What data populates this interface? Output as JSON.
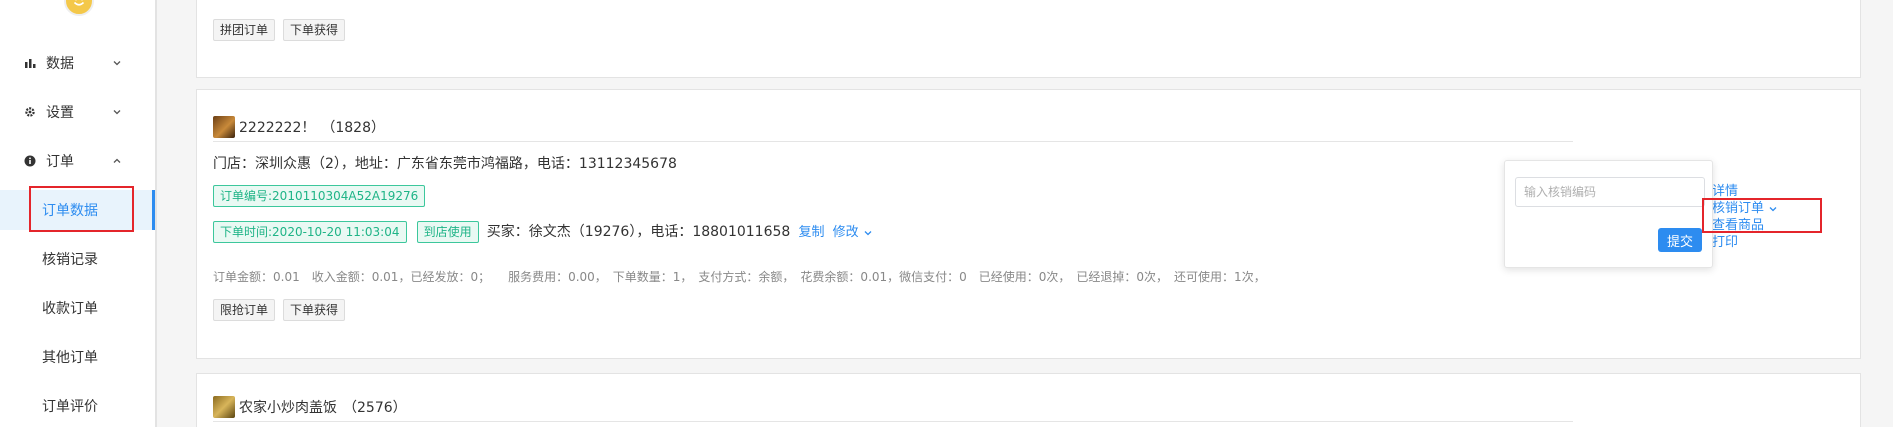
{
  "sidebar": {
    "groups": [
      {
        "label": "数据",
        "icon": "bar-chart-icon",
        "expanded": false
      },
      {
        "label": "设置",
        "icon": "gear-icon",
        "expanded": false
      },
      {
        "label": "订单",
        "icon": "info-circle-icon",
        "expanded": true
      }
    ],
    "order_items": [
      "订单数据",
      "核销记录",
      "收款订单",
      "其他订单",
      "订单评价"
    ],
    "active_item": "订单数据"
  },
  "order_prev": {
    "tags": [
      "拼团订单",
      "下单获得"
    ]
  },
  "order_main": {
    "shop_name": "2222222！",
    "shop_id": "（1828）",
    "store_line": "门店：深圳众惠（2），地址：广东省东莞市鸿福路，电话：13112345678",
    "order_no": "订单编号:2010110304A52A19276",
    "order_time": "下单时间:2020-10-20 11:03:04",
    "use_type": "到店使用",
    "buyer_line": "买家：徐文杰（19276），电话：18801011658",
    "copy_label": "复制",
    "edit_label": "修改",
    "summary": "订单金额：0.01　收入金额：0.01，已经发放：0；　　服务费用：0.00，　下单数量：1，　支付方式：余额，　花费余额：0.01，微信支付：0　已经使用：0次，　已经退掉：0次，　还可使用：1次，",
    "tags": [
      "限抢订单",
      "下单获得"
    ]
  },
  "popover": {
    "placeholder": "输入核销编码",
    "submit_label": "提交"
  },
  "actions": {
    "detail": "详情",
    "verify": "核销订单",
    "view_goods": "查看商品",
    "print": "打印"
  },
  "order_next": {
    "shop_name": "农家小炒肉盖饭",
    "shop_id": "（2576）"
  },
  "colors": {
    "accent": "#2d8cf0",
    "green_tag": "#1fb487",
    "highlight_box": "#e4252b"
  }
}
